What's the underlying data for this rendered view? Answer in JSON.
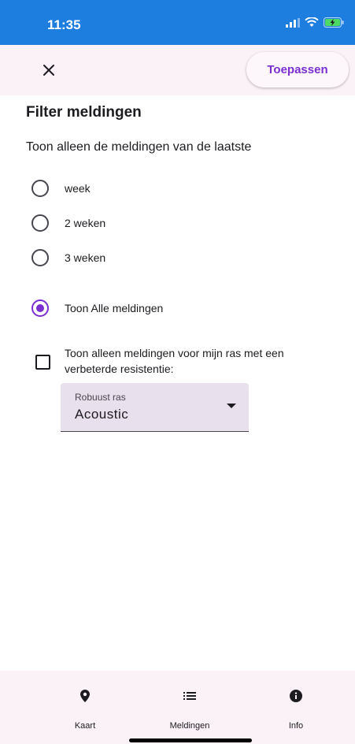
{
  "status_bar": {
    "time": "11:35"
  },
  "top_bar": {
    "apply_label": "Toepassen"
  },
  "page": {
    "title": "Filter meldingen",
    "subtitle": "Toon alleen de meldingen van de laatste"
  },
  "period_options": [
    {
      "label": "week",
      "selected": false
    },
    {
      "label": "2 weken",
      "selected": false
    },
    {
      "label": "3 weken",
      "selected": false
    },
    {
      "label": "Toon Alle meldingen",
      "selected": true
    }
  ],
  "resistance_filter": {
    "label": "Toon alleen meldingen voor mijn ras met een verbeterde resistentie:",
    "checked": false
  },
  "dropdown": {
    "label": "Robuust ras",
    "value": "Acoustic"
  },
  "bottom_nav": [
    {
      "label": "Kaart",
      "icon": "location-pin-icon"
    },
    {
      "label": "Meldingen",
      "icon": "list-icon"
    },
    {
      "label": "Info",
      "icon": "info-icon"
    }
  ],
  "colors": {
    "status_bar": "#1e7ee0",
    "accent": "#7b2fd0",
    "surface": "#fbf2f8",
    "dropdown_fill": "#e8e0ec"
  }
}
